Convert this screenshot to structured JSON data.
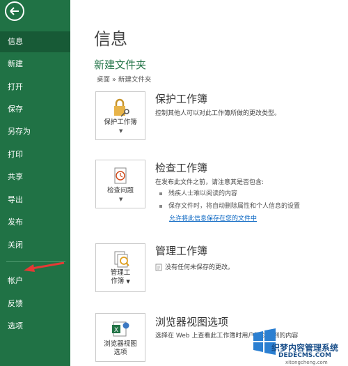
{
  "sidebar": {
    "items": [
      {
        "label": "信息",
        "active": true
      },
      {
        "label": "新建"
      },
      {
        "label": "打开"
      },
      {
        "label": "保存"
      },
      {
        "label": "另存为"
      },
      {
        "label": "打印"
      },
      {
        "label": "共享"
      },
      {
        "label": "导出"
      },
      {
        "label": "发布"
      },
      {
        "label": "关闭"
      },
      {
        "label": "帐户"
      },
      {
        "label": "反馈"
      },
      {
        "label": "选项"
      }
    ],
    "colors": {
      "background": "#207245",
      "active": "#175a36",
      "annotation_arrow": "#e53935"
    }
  },
  "main": {
    "page_title": "信息",
    "doc_title": "新建文件夹",
    "breadcrumb": "桌面 » 新建文件夹",
    "protect": {
      "button_label": "保护工作簿",
      "title": "保护工作簿",
      "desc": "控制其他人可以对此工作簿所做的更改类型。"
    },
    "inspect": {
      "button_label": "检查问题",
      "title": "检查工作簿",
      "desc": "在发布此文件之前，请注意其是否包含:",
      "bullets": [
        "残疾人士难以阅读的内容",
        "保存文件时，将自动删除属性和个人信息的设置"
      ],
      "link": "允许将此信息保存在您的文件中"
    },
    "manage": {
      "button_label_1": "管理工",
      "button_label_2": "作簿",
      "title": "管理工作簿",
      "desc": "没有任何未保存的更改。"
    },
    "browser": {
      "button_label_1": "浏览器视图",
      "button_label_2": "选项",
      "title": "浏览器视图选项",
      "desc": "选择在 Web 上查看此工作簿时用户可以看到的内容"
    }
  },
  "watermark": {
    "text": "织梦内容管理系统",
    "url": "DEDECMS.COM",
    "sub": "xitongcheng.com"
  }
}
